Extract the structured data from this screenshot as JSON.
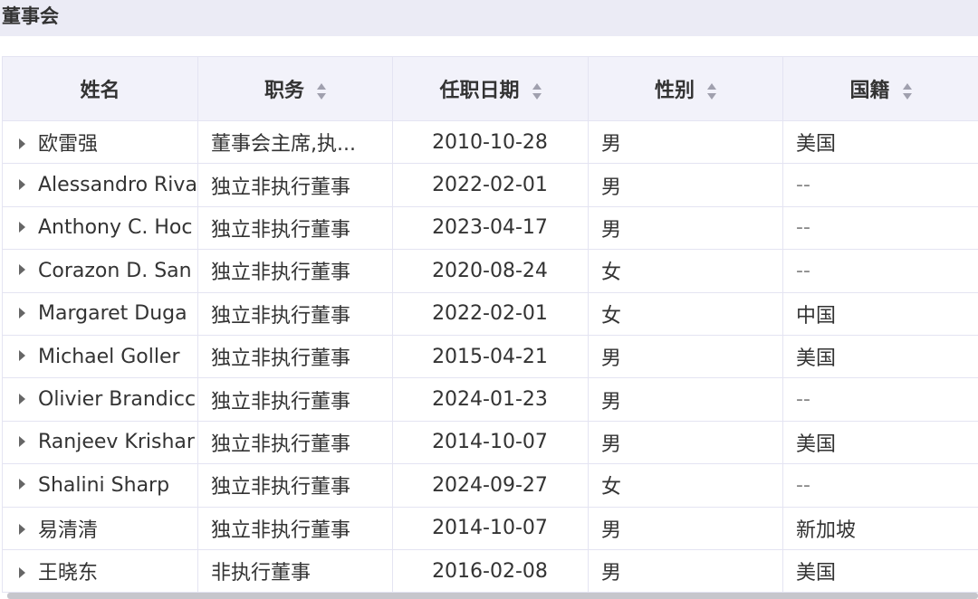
{
  "section": {
    "title": "董事会"
  },
  "table": {
    "headers": [
      "姓名",
      "职务",
      "任职日期",
      "性别",
      "国籍"
    ],
    "rows": [
      {
        "name": "欧雷强",
        "position": "董事会主席,执...",
        "date": "2010-10-28",
        "gender": "男",
        "nationality": "美国"
      },
      {
        "name": "Alessandro Riva",
        "position": "独立非执行董事",
        "date": "2022-02-01",
        "gender": "男",
        "nationality": "--"
      },
      {
        "name": "Anthony C. Hoc",
        "position": "独立非执行董事",
        "date": "2023-04-17",
        "gender": "男",
        "nationality": "--"
      },
      {
        "name": "Corazon D. San",
        "position": "独立非执行董事",
        "date": "2020-08-24",
        "gender": "女",
        "nationality": "--"
      },
      {
        "name": "Margaret Duga",
        "position": "独立非执行董事",
        "date": "2022-02-01",
        "gender": "女",
        "nationality": "中国"
      },
      {
        "name": "Michael Goller",
        "position": "独立非执行董事",
        "date": "2015-04-21",
        "gender": "男",
        "nationality": "美国"
      },
      {
        "name": "Olivier Brandicc",
        "position": "独立非执行董事",
        "date": "2024-01-23",
        "gender": "男",
        "nationality": "--"
      },
      {
        "name": "Ranjeev Krishar",
        "position": "独立非执行董事",
        "date": "2014-10-07",
        "gender": "男",
        "nationality": "美国"
      },
      {
        "name": "Shalini Sharp",
        "position": "独立非执行董事",
        "date": "2024-09-27",
        "gender": "女",
        "nationality": "--"
      },
      {
        "name": "易清清",
        "position": "独立非执行董事",
        "date": "2014-10-07",
        "gender": "男",
        "nationality": "新加坡"
      },
      {
        "name": "王晓东",
        "position": "非执行董事",
        "date": "2016-02-08",
        "gender": "男",
        "nationality": "美国"
      }
    ]
  },
  "colors": {
    "header_bg": "#f2f2fa",
    "title_bg": "#ebebf5",
    "border": "#e4e4f2"
  }
}
